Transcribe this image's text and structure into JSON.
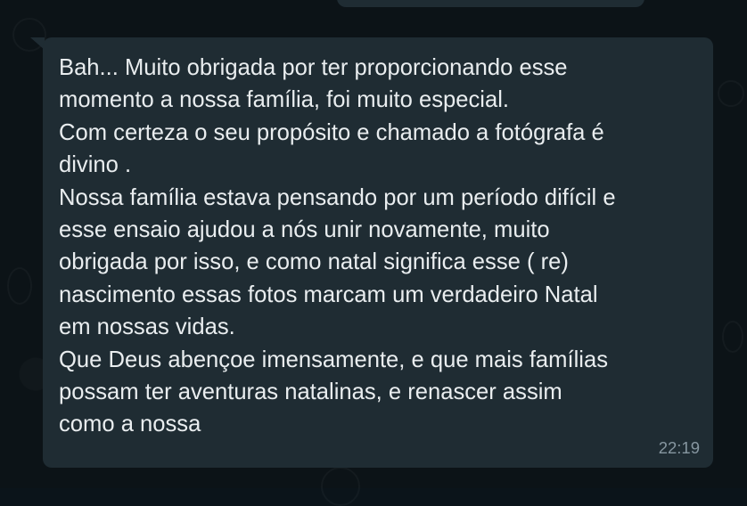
{
  "message": {
    "text": "Bah... Muito obrigada por ter proporcionando esse\nmomento a nossa família, foi muito especial.\nCom certeza o seu propósito e chamado a fotógrafa é\ndivino .\nNossa família estava pensando por um período difícil e\nesse ensaio ajudou a nós unir novamente, muito\nobrigada por isso, e como natal significa esse ( re)\nnascimento essas fotos marcam um verdadeiro Natal\nem nossas vidas.\nQue Deus abençoe imensamente, e que mais famílias\npossam ter aventuras natalinas, e renascer assim\ncomo a nossa",
    "time": "22:19"
  },
  "colors": {
    "chat_background": "#0c1317",
    "bubble": "#1f2c33",
    "message_text": "#e9edef",
    "time_text": "#8696a0"
  }
}
